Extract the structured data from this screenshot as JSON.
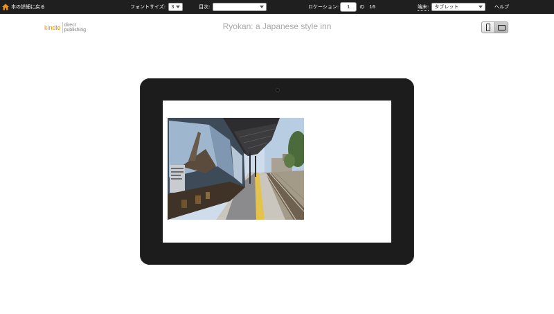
{
  "toolbar": {
    "back_label": "本の詳細に戻る",
    "font_size_label": "フォントサイズ:",
    "font_size_value": "3",
    "toc_label": "目次:",
    "toc_value": "",
    "location_label": "ロケーション:",
    "location_value": "1",
    "location_of": "の",
    "location_total": "16",
    "device_label": "端末:",
    "device_value": "タブレット",
    "help_label": "ヘルプ"
  },
  "header": {
    "logo_kindle": "kindle",
    "logo_direct": "direct",
    "logo_publishing": "publishing",
    "book_title": "Ryokan: a Japanese style inn"
  },
  "device_toggle": {
    "phone_icon": "phone-icon",
    "tablet_icon": "tablet-icon",
    "selected": "tablet"
  },
  "colors": {
    "toolbar_bg": "#1f1f1f",
    "logo_orange": "#f29111",
    "tablet_frame": "#1c1c1c"
  }
}
